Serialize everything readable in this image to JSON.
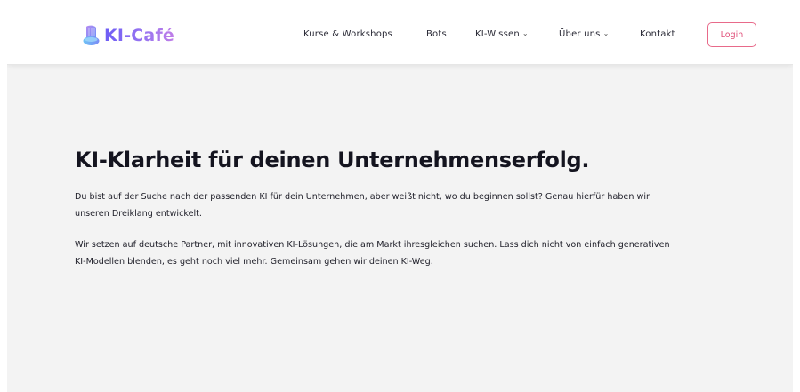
{
  "brand": {
    "name": "KI-Café"
  },
  "nav": {
    "items": [
      {
        "label": "Kurse & Workshops",
        "dropdown": false
      },
      {
        "label": "Bots",
        "dropdown": false
      },
      {
        "label": "KI-Wissen",
        "dropdown": true
      },
      {
        "label": "Über uns",
        "dropdown": true
      },
      {
        "label": "Kontakt",
        "dropdown": false
      }
    ],
    "login_label": "Login"
  },
  "hero": {
    "title": "KI-Klarheit für deinen Unternehmenserfolg.",
    "paragraphs": [
      "Du bist auf der Suche nach der passenden KI für dein Unternehmen, aber weißt nicht, wo du beginnen sollst? Genau hierfür haben wir unseren Dreiklang entwickelt.",
      "Wir setzen auf deutsche Partner, mit innovativen KI-Lösungen, die am Markt ihresgleichen suchen. Lass dich nicht von einfach generativen KI-Modellen blenden, es geht noch viel mehr. Gemeinsam gehen wir deinen KI-Weg."
    ]
  },
  "icons": {
    "dropdown": "chevron-down-icon",
    "logo": "coffee-cup-logo-icon"
  },
  "colors": {
    "brand_gradient_start": "#6d5df5",
    "brand_gradient_end": "#c07ee8",
    "login_border": "#e86a8a",
    "page_background": "#f3f3f3",
    "header_background": "#ffffff",
    "title_text": "#14141f"
  }
}
